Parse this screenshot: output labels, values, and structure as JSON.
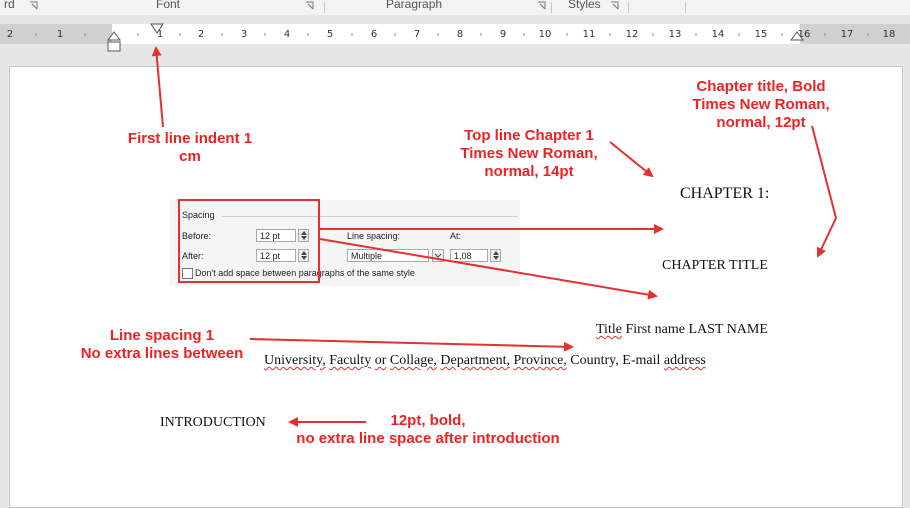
{
  "ribbon": {
    "labels": [
      "rd",
      "Font",
      "Paragraph",
      "Styles"
    ]
  },
  "ruler": {
    "left_numbers": [
      "2",
      "1"
    ],
    "right_numbers": [
      "1",
      "2",
      "3",
      "4",
      "5",
      "6",
      "7",
      "8",
      "9",
      "10",
      "11",
      "12",
      "13",
      "14",
      "15",
      "16",
      "17",
      "18"
    ]
  },
  "document": {
    "chapter_line": "CHAPTER 1:",
    "chapter_title": "CHAPTER TITLE",
    "author_line": {
      "title": "Title",
      "first_name": "First name",
      "last_name": "LAST NAME"
    },
    "affiliation": {
      "university": "University,",
      "faculty": "Faculty",
      "or": "or",
      "collage": "Collage,",
      "department": "Department,",
      "province": "Province,",
      "country": "Country,",
      "email": "E-mail",
      "address": "address"
    },
    "introduction": "INTRODUCTION"
  },
  "spacing_dialog": {
    "group_label": "Spacing",
    "before_label": "Before:",
    "before_value": "12 pt",
    "after_label": "After:",
    "after_value": "12 pt",
    "line_spacing_label": "Line spacing:",
    "line_spacing_value": "Multiple",
    "at_label": "At:",
    "at_value": "1,08",
    "checkbox_label": "Don't add space between paragraphs of the same style"
  },
  "annotations": {
    "first_line_indent": [
      "First line indent 1",
      "cm"
    ],
    "chapter_title_note": [
      "Chapter title, Bold",
      "Times New Roman,",
      "normal, 12pt"
    ],
    "top_line_note": [
      "Top line Chapter 1",
      "Times New Roman,",
      "normal, 14pt"
    ],
    "line_spacing_note": [
      "Line spacing 1",
      "No extra lines between"
    ],
    "introduction_note": [
      "12pt, bold,",
      "no extra line space after introduction"
    ]
  },
  "colors": {
    "annotation_red": "#ee2222",
    "arrow_red": "#e53030",
    "spellcheck_red": "#dd3333"
  }
}
